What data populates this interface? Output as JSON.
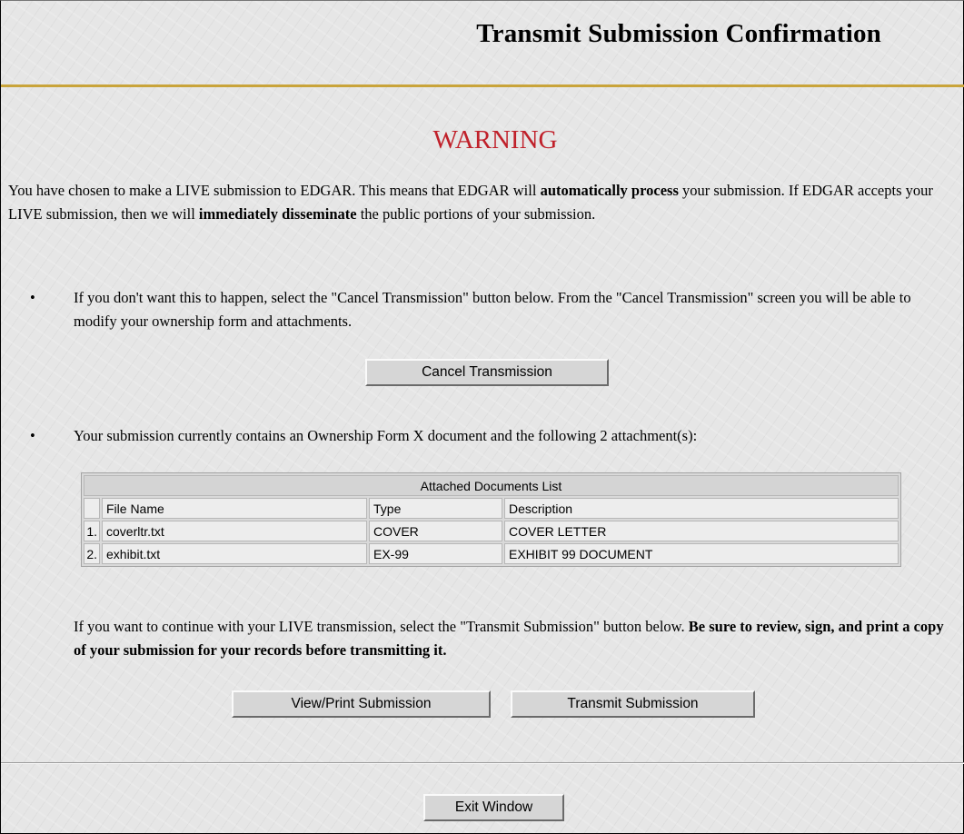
{
  "header": {
    "title": "Transmit Submission Confirmation"
  },
  "warning": {
    "heading": "WARNING"
  },
  "intro": {
    "p1": "You have chosen to make a LIVE submission to EDGAR. This means that EDGAR will ",
    "b1": "automatically process",
    "p2": " your submission. If EDGAR accepts your LIVE submission, then we will ",
    "b2": "immediately disseminate",
    "p3": " the public portions of your submission."
  },
  "bullets": {
    "cancel_text": "If you don't want this to happen, select the \"Cancel Transmission\" button below. From the \"Cancel Transmission\" screen you will be able to modify your ownership form and attachments.",
    "contents_text": "Your submission currently contains an Ownership Form X document and the following 2 attachment(s):",
    "dot": "•"
  },
  "buttons": {
    "cancel": "Cancel Transmission",
    "view_print": "View/Print Submission",
    "transmit": "Transmit Submission",
    "exit": "Exit Window"
  },
  "attachments": {
    "caption": "Attached Documents List",
    "columns": [
      "File Name",
      "Type",
      "Description"
    ],
    "rows": [
      {
        "num": "1.",
        "file": "coverltr.txt",
        "type": "COVER",
        "description": "COVER LETTER"
      },
      {
        "num": "2.",
        "file": "exhibit.txt",
        "type": "EX-99",
        "description": "EXHIBIT 99 DOCUMENT"
      }
    ]
  },
  "continue": {
    "text": "If you want to continue with your LIVE transmission, select the \"Transmit Submission\" button below. ",
    "bold": "Be sure to review, sign, and print a copy of your submission for your records before transmitting it."
  },
  "colors": {
    "warning": "#c0202a",
    "title_rule": "#c9a43a",
    "background": "#e6e6e6"
  }
}
